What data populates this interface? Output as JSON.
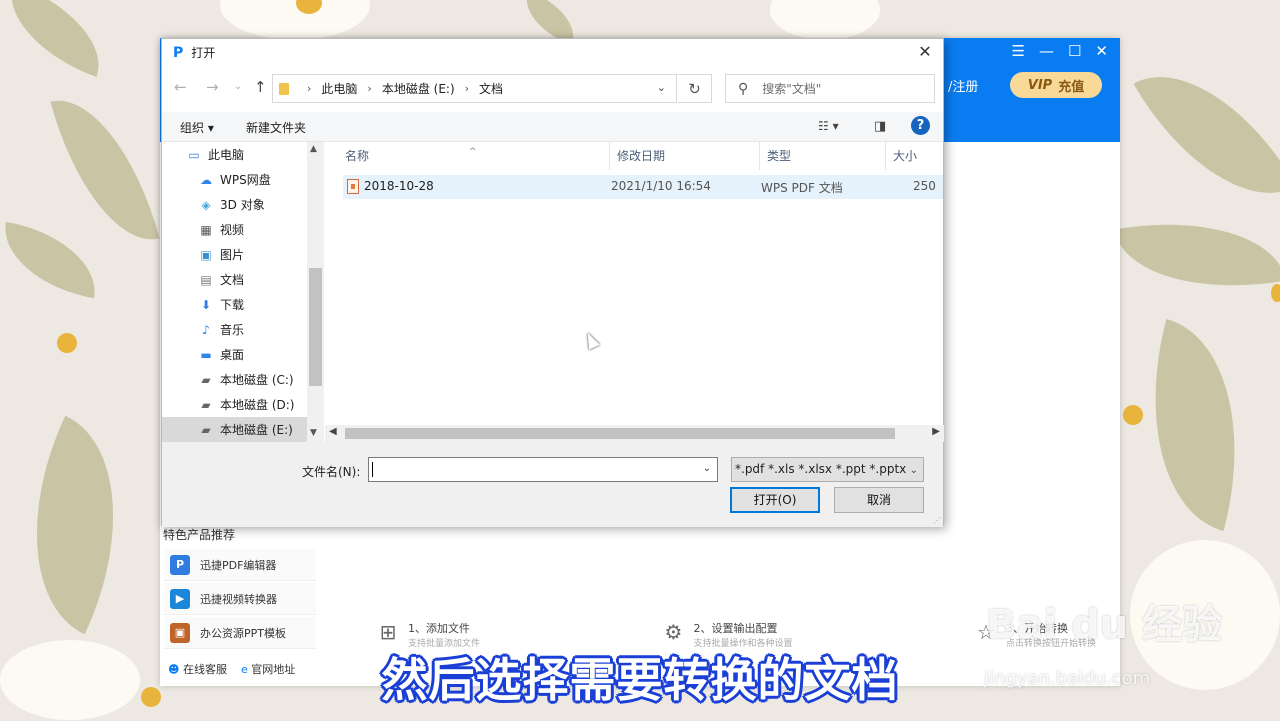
{
  "app": {
    "window_controls": [
      "☰",
      "—",
      "☐",
      "✕"
    ],
    "login_text": "/注册",
    "vip_label": "VIP",
    "vip_action": "充值",
    "featured_title": "特色产品推荐",
    "featured": [
      {
        "label": "迅捷PDF编辑器",
        "color": "#2f7de1",
        "icon": "pdf-editor-icon"
      },
      {
        "label": "迅捷视频转换器",
        "color": "#1c86d8",
        "icon": "video-converter-icon"
      },
      {
        "label": "办公资源PPT模板",
        "color": "#c0652a",
        "icon": "ppt-template-icon"
      }
    ],
    "links": [
      "在线客服",
      "官网地址"
    ],
    "steps": [
      {
        "title": "1、添加文件",
        "desc": "支持批量添加文件"
      },
      {
        "title": "2、设置输出配置",
        "desc": "支持批量操作和各种设置"
      },
      {
        "title": "3、开始转换",
        "desc": "点击转换按钮开始转换"
      }
    ]
  },
  "dialog": {
    "title": "打开",
    "breadcrumb": [
      "此电脑",
      "本地磁盘 (E:)",
      "文档"
    ],
    "search_placeholder": "搜索\"文档\"",
    "toolbar": {
      "organize": "组织 ▾",
      "new_folder": "新建文件夹"
    },
    "tree": [
      {
        "label": "此电脑",
        "icon": "computer-icon",
        "root": true
      },
      {
        "label": "WPS网盘",
        "icon": "cloud-icon"
      },
      {
        "label": "3D 对象",
        "icon": "3d-objects-icon"
      },
      {
        "label": "视频",
        "icon": "video-icon"
      },
      {
        "label": "图片",
        "icon": "pictures-icon"
      },
      {
        "label": "文档",
        "icon": "documents-icon"
      },
      {
        "label": "下载",
        "icon": "download-icon"
      },
      {
        "label": "音乐",
        "icon": "music-icon"
      },
      {
        "label": "桌面",
        "icon": "desktop-icon"
      },
      {
        "label": "本地磁盘 (C:)",
        "icon": "drive-icon"
      },
      {
        "label": "本地磁盘 (D:)",
        "icon": "drive-icon"
      },
      {
        "label": "本地磁盘 (E:)",
        "icon": "drive-icon",
        "selected": true
      }
    ],
    "columns": [
      "名称",
      "修改日期",
      "类型",
      "大小"
    ],
    "files": [
      {
        "name": "2018-10-28",
        "modified": "2021/1/10 16:54",
        "type": "WPS PDF 文档",
        "size": "250"
      }
    ],
    "filename_label": "文件名(N):",
    "filename_value": "",
    "filter": "*.pdf *.xls *.xlsx *.ppt *.pptx",
    "open_button": "打开(O)",
    "cancel_button": "取消"
  },
  "subtitle": "然后选择需要转换的文档",
  "watermark": {
    "brand": "Bai du 经验",
    "url": "jingyan.baidu.com"
  }
}
